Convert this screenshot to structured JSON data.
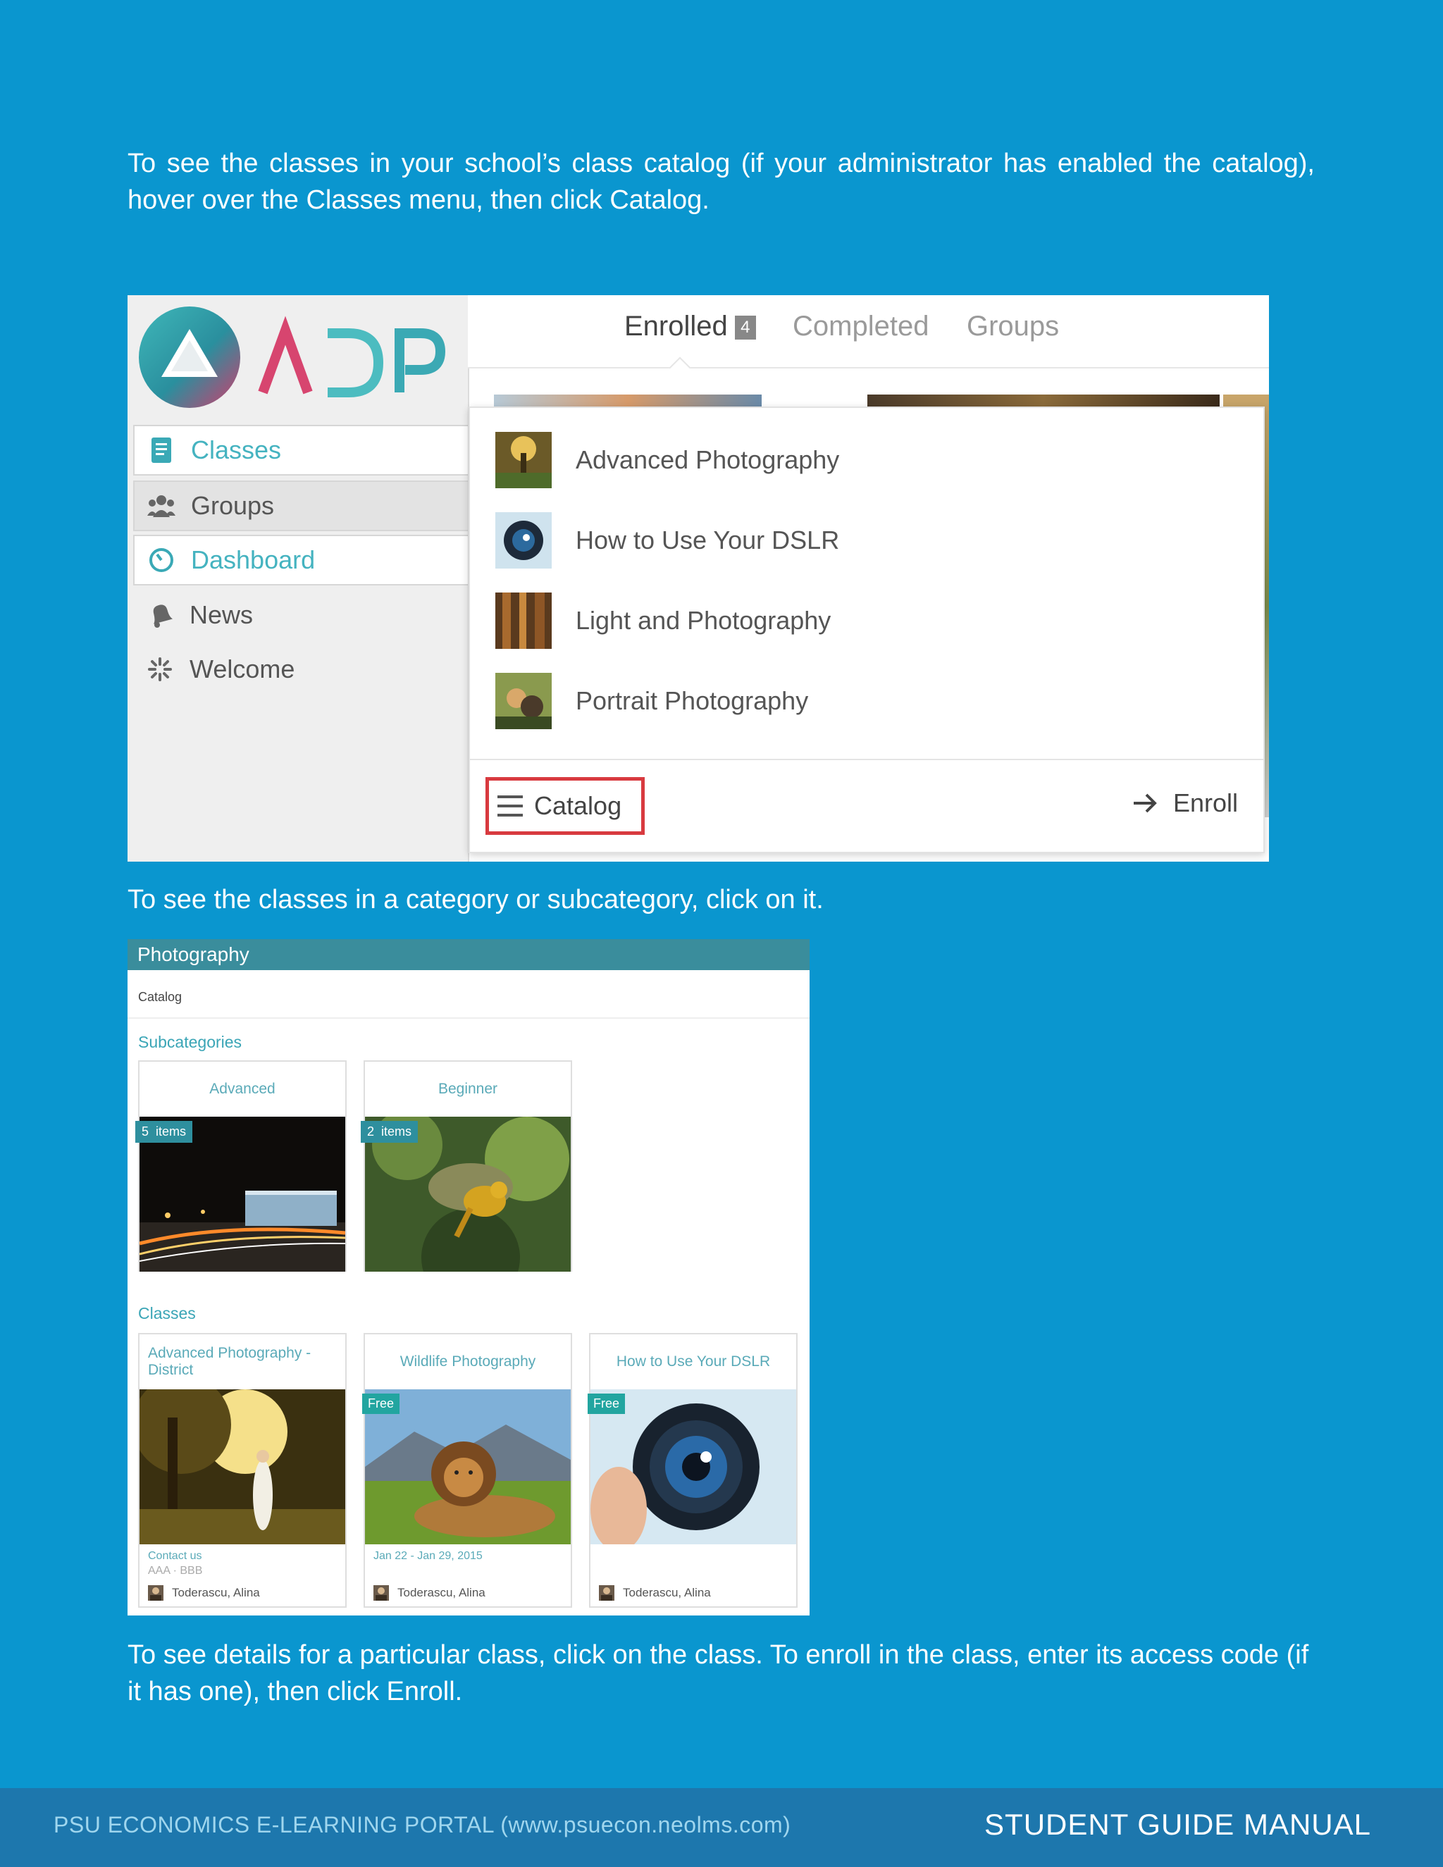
{
  "intro_text": "To see the classes in your school’s class catalog (if your administrator has enabled the catalog), hover over the Classes menu, then click Catalog.",
  "screenshot1": {
    "logo_text": "ADP",
    "sidebar": [
      {
        "label": "Classes",
        "icon": "classes-book-icon"
      },
      {
        "label": "Groups",
        "icon": "groups-icon"
      },
      {
        "label": "Dashboard",
        "icon": "dashboard-gauge-icon"
      },
      {
        "label": "News",
        "icon": "news-bell-icon"
      },
      {
        "label": "Welcome",
        "icon": "welcome-sparkle-icon"
      }
    ],
    "tabs": [
      {
        "label": "Enrolled",
        "badge": "4"
      },
      {
        "label": "Completed"
      },
      {
        "label": "Groups"
      }
    ],
    "dropdown_items": [
      {
        "label": "Advanced Photography"
      },
      {
        "label": "How to Use Your DSLR"
      },
      {
        "label": "Light and Photography"
      },
      {
        "label": "Portrait Photography"
      }
    ],
    "catalog_label": "Catalog",
    "enroll_label": "Enroll",
    "colors": {
      "highlight_border": "#d83a3f",
      "accent": "#45b3c0"
    }
  },
  "category_text": "To see the classes in a category or subcategory, click on it.",
  "screenshot2": {
    "header_title": "Photography",
    "breadcrumb": "Catalog",
    "subcategories_heading": "Subcategories",
    "subcategories": [
      {
        "title": "Advanced",
        "items_count": "5",
        "items_label": "items"
      },
      {
        "title": "Beginner",
        "items_count": "2",
        "items_label": "items"
      }
    ],
    "classes_heading": "Classes",
    "classes": [
      {
        "title": "Advanced Photography - District",
        "badge": "",
        "meta_link": "Contact us",
        "meta_sub": "AAA · BBB",
        "owner": "Toderascu, Alina"
      },
      {
        "title": "Wildlife Photography",
        "badge": "Free",
        "meta_link": "Jan 22 - Jan 29, 2015",
        "meta_sub": "",
        "owner": "Toderascu, Alina"
      },
      {
        "title": "How to Use Your DSLR",
        "badge": "Free",
        "meta_link": "",
        "meta_sub": "",
        "owner": "Toderascu, Alina"
      }
    ]
  },
  "details_text": "To see details for a particular class, click on the class. To enroll in the class, enter its access code (if it has one), then click Enroll.",
  "footer": {
    "left": "PSU ECONOMICS E-LEARNING PORTAL (www.psuecon.neolms.com)",
    "right": "STUDENT GUIDE MANUAL"
  }
}
